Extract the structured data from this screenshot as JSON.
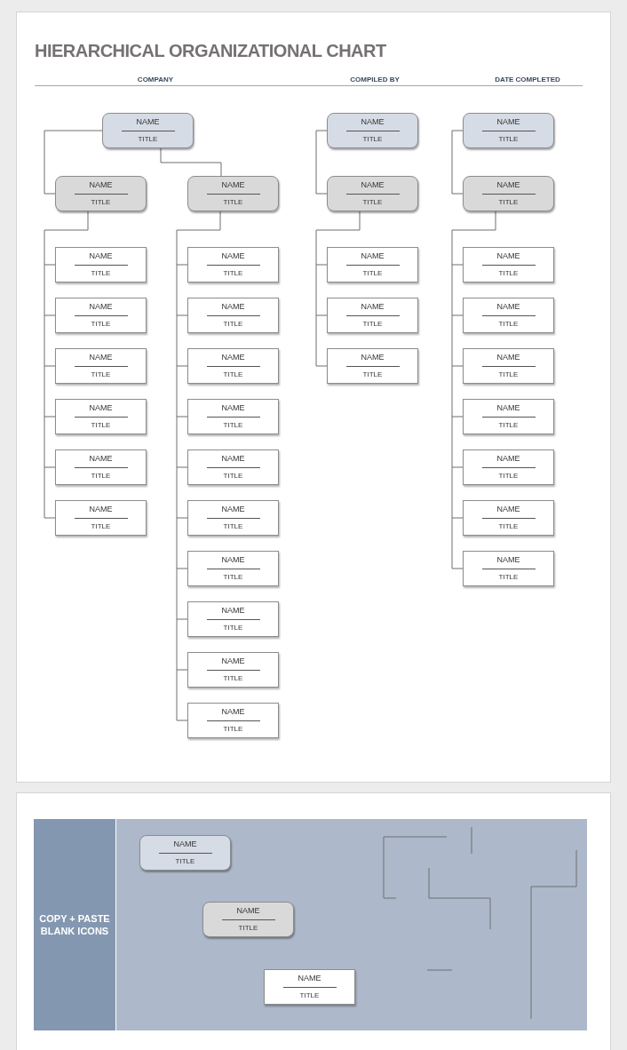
{
  "title": "HIERARCHICAL ORGANIZATIONAL CHART",
  "fields": [
    "COMPANY",
    "COMPILED BY",
    "DATE COMPLETED"
  ],
  "chart": [
    {
      "kind": "top",
      "name": "NAME",
      "title": "TITLE",
      "children": [
        {
          "kind": "mid",
          "name": "NAME",
          "title": "TITLE",
          "children": [
            {
              "kind": "leaf",
              "name": "NAME",
              "title": "TITLE"
            },
            {
              "kind": "leaf",
              "name": "NAME",
              "title": "TITLE"
            },
            {
              "kind": "leaf",
              "name": "NAME",
              "title": "TITLE"
            },
            {
              "kind": "leaf",
              "name": "NAME",
              "title": "TITLE"
            },
            {
              "kind": "leaf",
              "name": "NAME",
              "title": "TITLE"
            },
            {
              "kind": "leaf",
              "name": "NAME",
              "title": "TITLE"
            }
          ]
        },
        {
          "kind": "mid",
          "name": "NAME",
          "title": "TITLE",
          "children": [
            {
              "kind": "leaf",
              "name": "NAME",
              "title": "TITLE"
            },
            {
              "kind": "leaf",
              "name": "NAME",
              "title": "TITLE"
            },
            {
              "kind": "leaf",
              "name": "NAME",
              "title": "TITLE"
            },
            {
              "kind": "leaf",
              "name": "NAME",
              "title": "TITLE"
            },
            {
              "kind": "leaf",
              "name": "NAME",
              "title": "TITLE"
            },
            {
              "kind": "leaf",
              "name": "NAME",
              "title": "TITLE"
            },
            {
              "kind": "leaf",
              "name": "NAME",
              "title": "TITLE"
            },
            {
              "kind": "leaf",
              "name": "NAME",
              "title": "TITLE"
            },
            {
              "kind": "leaf",
              "name": "NAME",
              "title": "TITLE"
            },
            {
              "kind": "leaf",
              "name": "NAME",
              "title": "TITLE"
            }
          ]
        }
      ]
    },
    {
      "kind": "top",
      "name": "NAME",
      "title": "TITLE",
      "children": [
        {
          "kind": "mid",
          "name": "NAME",
          "title": "TITLE",
          "children": [
            {
              "kind": "leaf",
              "name": "NAME",
              "title": "TITLE"
            },
            {
              "kind": "leaf",
              "name": "NAME",
              "title": "TITLE"
            },
            {
              "kind": "leaf",
              "name": "NAME",
              "title": "TITLE"
            }
          ]
        }
      ]
    },
    {
      "kind": "top",
      "name": "NAME",
      "title": "TITLE",
      "children": [
        {
          "kind": "mid",
          "name": "NAME",
          "title": "TITLE",
          "children": [
            {
              "kind": "leaf",
              "name": "NAME",
              "title": "TITLE"
            },
            {
              "kind": "leaf",
              "name": "NAME",
              "title": "TITLE"
            },
            {
              "kind": "leaf",
              "name": "NAME",
              "title": "TITLE"
            },
            {
              "kind": "leaf",
              "name": "NAME",
              "title": "TITLE"
            },
            {
              "kind": "leaf",
              "name": "NAME",
              "title": "TITLE"
            },
            {
              "kind": "leaf",
              "name": "NAME",
              "title": "TITLE"
            },
            {
              "kind": "leaf",
              "name": "NAME",
              "title": "TITLE"
            }
          ]
        }
      ]
    }
  ],
  "copy_panel": {
    "label": "COPY + PASTE BLANK ICONS",
    "samples": [
      {
        "kind": "top",
        "name": "NAME",
        "title": "TITLE"
      },
      {
        "kind": "mid",
        "name": "NAME",
        "title": "TITLE"
      },
      {
        "kind": "leaf",
        "name": "NAME",
        "title": "TITLE"
      }
    ]
  }
}
